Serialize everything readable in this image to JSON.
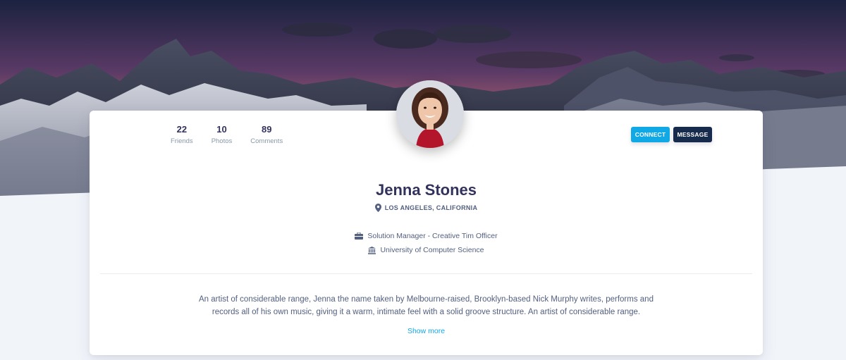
{
  "profile": {
    "stats": [
      {
        "value": "22",
        "label": "Friends"
      },
      {
        "value": "10",
        "label": "Photos"
      },
      {
        "value": "89",
        "label": "Comments"
      }
    ],
    "buttons": {
      "connect": "CONNECT",
      "message": "MESSAGE"
    },
    "name": "Jenna Stones",
    "location": "LOS ANGELES, CALIFORNIA",
    "job": "Solution Manager - Creative Tim Officer",
    "education": "University of Computer Science",
    "bio": "An artist of considerable range, Jenna the name taken by Melbourne-raised, Brooklyn-based Nick Murphy writes, performs and records all of his own music, giving it a warm, intimate feel with a solid groove structure. An artist of considerable range.",
    "show_more": "Show more"
  },
  "icons": {
    "location": "map-pin-icon",
    "job": "briefcase-icon",
    "education": "university-icon"
  },
  "colors": {
    "primary": "#11a8e6",
    "dark": "#172b4d",
    "heading": "#32325d",
    "muted": "#8898aa",
    "page_bg": "#f1f4f9"
  }
}
